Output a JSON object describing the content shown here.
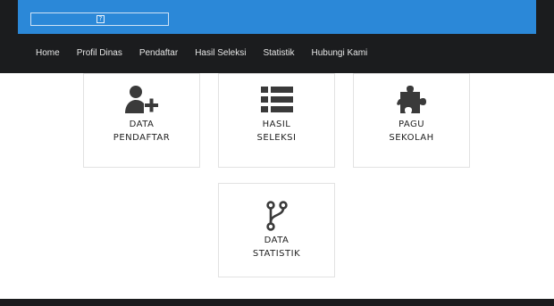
{
  "header": {
    "logo_glyph": "?"
  },
  "nav": {
    "items": [
      {
        "label": "Home"
      },
      {
        "label": "Profil Dinas"
      },
      {
        "label": "Pendaftar"
      },
      {
        "label": "Hasil Seleksi"
      },
      {
        "label": "Statistik"
      },
      {
        "label": "Hubungi Kami"
      }
    ]
  },
  "cards": [
    {
      "line1": "DATA",
      "line2": "PENDAFTAR",
      "icon": "user-plus-icon"
    },
    {
      "line1": "HASIL",
      "line2": "SELEKSI",
      "icon": "list-icon"
    },
    {
      "line1": "PAGU",
      "line2": "SEKOLAH",
      "icon": "puzzle-icon"
    },
    {
      "line1": "DATA",
      "line2": "STATISTIK",
      "icon": "branch-icon"
    }
  ],
  "colors": {
    "brand_blue": "#2b88d8",
    "dark_bar": "#1b1c1e",
    "icon": "#3a3a3a"
  }
}
